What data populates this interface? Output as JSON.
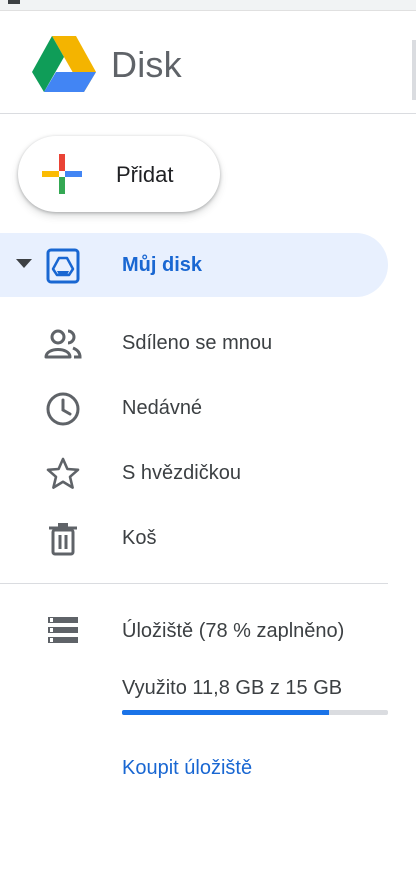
{
  "app": {
    "title": "Disk"
  },
  "new_button": {
    "label": "Přidat"
  },
  "nav": {
    "items": [
      {
        "label": "Můj disk",
        "icon": "my-drive-icon",
        "active": true
      },
      {
        "label": "Sdíleno se mnou",
        "icon": "shared-people-icon"
      },
      {
        "label": "Nedávné",
        "icon": "clock-icon"
      },
      {
        "label": "S hvězdičkou",
        "icon": "star-icon"
      },
      {
        "label": "Koš",
        "icon": "trash-icon"
      }
    ]
  },
  "storage": {
    "title": "Úložiště (78 % zaplněno)",
    "usage_text": "Využito 11,8 GB z 15 GB",
    "used_fraction": 0.78,
    "buy_label": "Koupit úložiště",
    "icon": "storage-icon"
  },
  "colors": {
    "accent": "#1967d2",
    "active_bg": "#e8f0fe",
    "progress": "#1a73e8",
    "drive_green": "#0f9d58",
    "drive_yellow": "#f4b400",
    "drive_blue": "#4285f4"
  }
}
